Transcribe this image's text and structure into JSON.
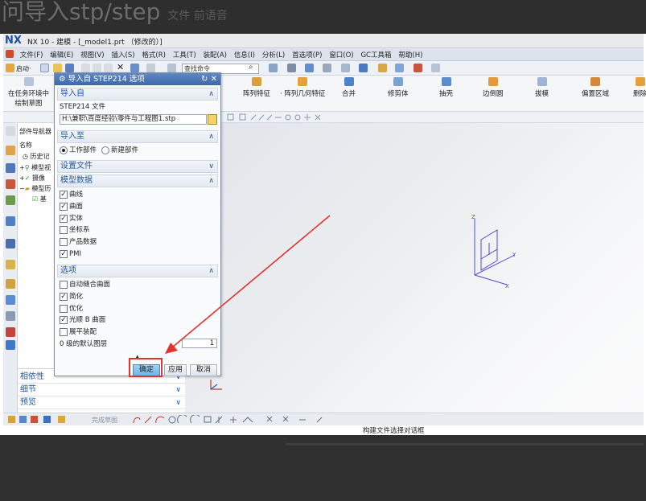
{
  "banner": {
    "main": "问导入stp/step",
    "sub": "文件 前语音"
  },
  "window": {
    "logo": "NX",
    "title": "NX 10 - 建模 - [_model1.prt （修改的）]"
  },
  "menu": [
    "文件(F)",
    "编辑(E)",
    "视图(V)",
    "插入(S)",
    "格式(R)",
    "工具(T)",
    "装配(A)",
    "信息(I)",
    "分析(L)",
    "首选项(P)",
    "窗口(O)",
    "GC工具箱",
    "帮助(H)"
  ],
  "toolbar": {
    "start_label": "启动·",
    "search_placeholder": "查找命令"
  },
  "ribbon": {
    "sketch_label_1": "在任务环境中",
    "sketch_label_2": "绘制草图",
    "items": [
      "阵列特征",
      "阵列几何特征",
      "合并",
      "修剪体",
      "抽壳",
      "边倒圆",
      "拔模",
      "偏置区域",
      "删除"
    ]
  },
  "navigator": {
    "title": "部件导航器",
    "col_name": "名称",
    "rows": [
      "历史记",
      "模型视",
      "摄像",
      "模型历",
      "基"
    ]
  },
  "lower_panel": {
    "items": [
      "相依性",
      "细节",
      "预览"
    ]
  },
  "dialog": {
    "title": "导入自 STEP214 选项",
    "sections": {
      "import_from": {
        "header": "导入自",
        "file_label": "STEP214 文件",
        "file_path": "H:\\兼职\\百度经验\\零件与工程图1.stp"
      },
      "import_to": {
        "header": "导入至",
        "options": [
          {
            "label": "工作部件",
            "selected": true
          },
          {
            "label": "新建部件",
            "selected": false
          }
        ]
      },
      "settings_file": {
        "header": "设置文件"
      },
      "model_data": {
        "header": "模型数据",
        "items": [
          {
            "label": "曲线",
            "checked": true
          },
          {
            "label": "曲面",
            "checked": true
          },
          {
            "label": "实体",
            "checked": true
          },
          {
            "label": "坐标系",
            "checked": false
          },
          {
            "label": "产品数据",
            "checked": false
          },
          {
            "label": "PMI",
            "checked": true
          }
        ]
      },
      "options": {
        "header": "选项",
        "items": [
          {
            "label": "自动缝合曲面",
            "checked": false
          },
          {
            "label": "简化",
            "checked": true
          },
          {
            "label": "优化",
            "checked": false
          },
          {
            "label": "光顺 B 曲面",
            "checked": true
          },
          {
            "label": "展平装配",
            "checked": false
          }
        ],
        "layer_label": "0 级的默认图层",
        "layer_value": "1"
      }
    },
    "buttons": {
      "ok": "确定",
      "apply": "应用",
      "cancel": "取消"
    }
  },
  "statusbar": {
    "sketch_finish": "完成草图",
    "status_text": "构建文件选择对话框"
  },
  "csys": {
    "z": "Z",
    "y": "Y",
    "x": "X"
  },
  "colors": {
    "annotation_red": "#e4322f",
    "dialog_header": "#3e68aa",
    "section_text": "#1f56a0"
  }
}
